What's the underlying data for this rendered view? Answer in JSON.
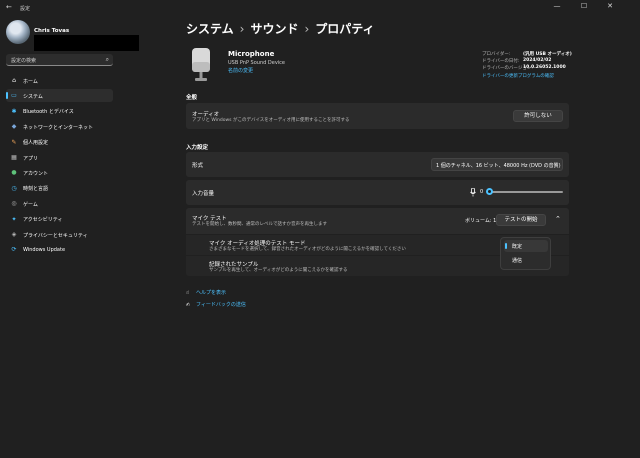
{
  "window": {
    "title": "設定",
    "back": "←",
    "minimize": "—",
    "maximize": "☐",
    "close": "✕"
  },
  "user": {
    "name": "Chris Tovas"
  },
  "search": {
    "placeholder": "設定の検索",
    "icon": "⌕"
  },
  "nav": [
    {
      "label": "ホーム",
      "icon": "⌂",
      "color": "#ffffff"
    },
    {
      "label": "システム",
      "icon": "▭",
      "color": "#4cc2ff",
      "selected": true
    },
    {
      "label": "Bluetooth とデバイス",
      "icon": "✱",
      "color": "#4cc2ff"
    },
    {
      "label": "ネットワークとインターネット",
      "icon": "◆",
      "color": "#7aa6d9"
    },
    {
      "label": "個人用設定",
      "icon": "✎",
      "color": "#f2a65a"
    },
    {
      "label": "アプリ",
      "icon": "▦",
      "color": "#b9b9b9"
    },
    {
      "label": "アカウント",
      "icon": "●",
      "color": "#5ec27a"
    },
    {
      "label": "時刻と言語",
      "icon": "◷",
      "color": "#4cc2ff"
    },
    {
      "label": "ゲーム",
      "icon": "◎",
      "color": "#b9b9b9"
    },
    {
      "label": "アクセシビリティ",
      "icon": "✦",
      "color": "#4cc2ff"
    },
    {
      "label": "プライバシーとセキュリティ",
      "icon": "◈",
      "color": "#b9b9b9"
    },
    {
      "label": "Windows Update",
      "icon": "⟳",
      "color": "#4cc2ff"
    }
  ],
  "breadcrumb": [
    "システム",
    "サウンド",
    "プロパティ"
  ],
  "breadcrumb_sep": "›",
  "device": {
    "name": "Microphone",
    "subtitle": "USB PnP Sound Device",
    "rename": "名前の変更"
  },
  "properties": [
    {
      "key": "プロバイダー:",
      "value": "(汎用 USB オーディオ)"
    },
    {
      "key": "ドライバーの日付:",
      "value": "2024/02/02"
    },
    {
      "key": "ドライバーのバージョン:",
      "value": "10.0.26052.1000"
    }
  ],
  "driver_link": "ドライバーの更新プログラムの確認",
  "general": {
    "heading": "全般",
    "audio_title": "オーディオ",
    "audio_desc": "アプリと Windows がこのデバイスをオーディオ用に使用することを許可する",
    "audio_button": "許可しない"
  },
  "input": {
    "heading": "入力設定",
    "format_label": "形式",
    "format_value": "1 個のチャネル、16 ビット、48000 Hz (DVD の音質)",
    "volume_label": "入力音量",
    "volume_value": "0",
    "volume_level": 0
  },
  "mic_test": {
    "title": "マイク テスト",
    "desc": "テストを開始し、数秒間、通常のレベルで話すか音声を再生します",
    "volume_text": "ボリューム: 1%",
    "start_button": "テストの開始",
    "mode_title": "マイク オーディオ処理のテスト モード",
    "mode_desc": "さまざまなモードを選択して、録音されたオーディオがどのように聞こえるかを確認してください",
    "sample_title": "記録されたサンプル",
    "sample_desc": "サンプルを再生して、オーディオがどのように聞こえるかを確認する",
    "options": [
      "既定",
      "通信"
    ],
    "selected_option": "既定"
  },
  "links": [
    {
      "icon": "☝",
      "label": "ヘルプを表示"
    },
    {
      "icon": "✍",
      "label": "フィードバックの送信"
    }
  ],
  "colors": {
    "accent": "#4cc2ff",
    "background": "#202020",
    "card": "#2b2b2b"
  }
}
